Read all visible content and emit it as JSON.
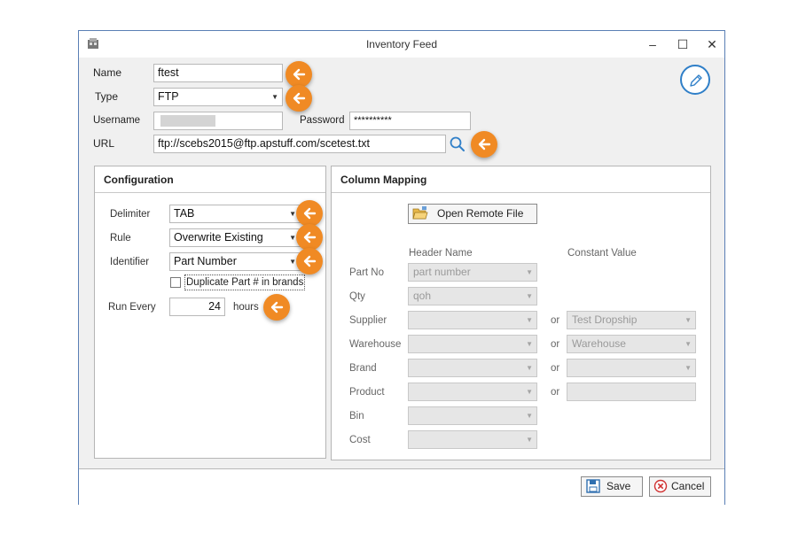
{
  "window": {
    "title": "Inventory Feed",
    "minimize": "–",
    "maximize": "☐",
    "close": "✕"
  },
  "form": {
    "name_label": "Name",
    "name_value": "ftest",
    "type_label": "Type",
    "type_value": "FTP",
    "username_label": "Username",
    "password_label": "Password",
    "password_value": "**********",
    "url_label": "URL",
    "url_value": "ftp://scebs2015@ftp.apstuff.com/scetest.txt"
  },
  "configuration": {
    "title": "Configuration",
    "delimiter_label": "Delimiter",
    "delimiter_value": "TAB",
    "rule_label": "Rule",
    "rule_value": "Overwrite Existing",
    "identifier_label": "Identifier",
    "identifier_value": "Part Number",
    "duplicate_label": "Duplicate Part # in brands",
    "run_every_label": "Run Every",
    "run_every_value": "24",
    "hours_label": "hours"
  },
  "mapping": {
    "title": "Column Mapping",
    "open_remote_label": "Open Remote File",
    "header_name": "Header Name",
    "constant_value": "Constant Value",
    "or_label": "or",
    "rows": [
      {
        "label": "Part No",
        "header": "part number"
      },
      {
        "label": "Qty",
        "header": "qoh"
      },
      {
        "label": "Supplier",
        "header": "",
        "constant": "Test Dropship"
      },
      {
        "label": "Warehouse",
        "header": "",
        "constant": "Warehouse"
      },
      {
        "label": "Brand",
        "header": "",
        "constant": ""
      },
      {
        "label": "Product",
        "header": "",
        "constant": ""
      },
      {
        "label": "Bin",
        "header": ""
      },
      {
        "label": "Cost",
        "header": ""
      }
    ]
  },
  "footer": {
    "save_label": "Save",
    "cancel_label": "Cancel"
  },
  "colors": {
    "accent_arrow": "#f08a24",
    "edit_icon": "#2f7fc8",
    "window_border": "#5a7fb5"
  }
}
